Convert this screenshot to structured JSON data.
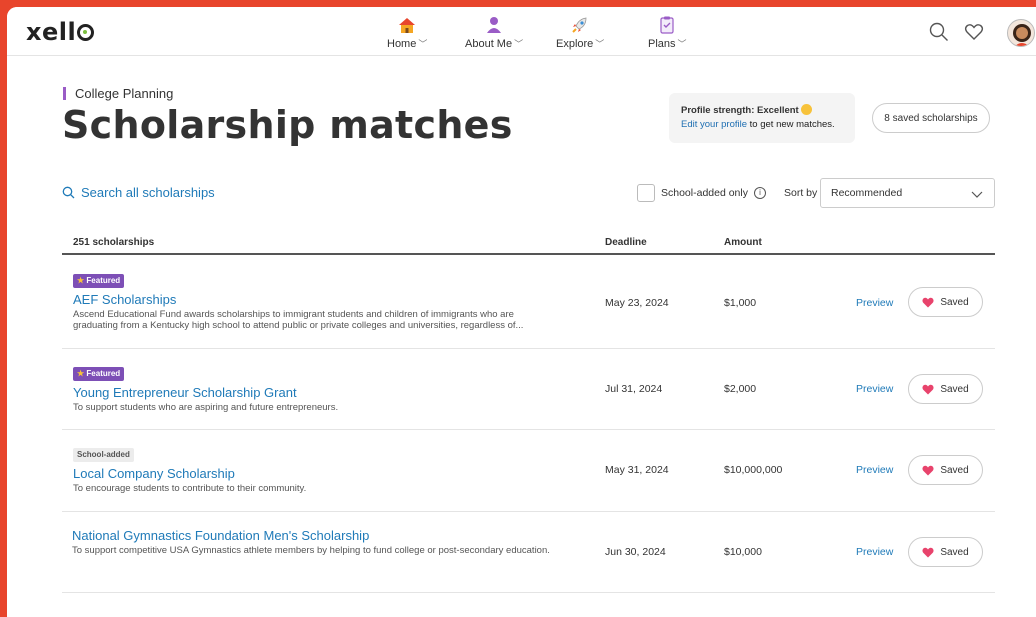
{
  "header": {
    "logo": "xello",
    "nav": [
      {
        "label": "Home",
        "icon": "house-icon"
      },
      {
        "label": "About Me",
        "icon": "person-icon"
      },
      {
        "label": "Explore",
        "icon": "rocket-icon"
      },
      {
        "label": "Plans",
        "icon": "clipboard-icon"
      }
    ]
  },
  "page": {
    "breadcrumb": "College Planning",
    "title": "Scholarship matches",
    "profile_strength": "Profile strength: Excellent",
    "profile_link": "Edit your profile",
    "profile_suffix": " to get new matches.",
    "saved_count_button": "8 saved scholarships"
  },
  "filters": {
    "search_label": "Search all scholarships",
    "school_added_label": "School-added only",
    "sort_label": "Sort by",
    "sort_value": "Recommended"
  },
  "table": {
    "columns": {
      "count": "251 scholarships",
      "deadline": "Deadline",
      "amount": "Amount"
    },
    "rows": [
      {
        "badge": "Featured",
        "title": "AEF Scholarships",
        "description": "Ascend Educational Fund awards scholarships to immigrant students and children of immigrants who are graduating from a Kentucky high school to attend public or private colleges and universities, regardless of...",
        "deadline": "May 23, 2024",
        "amount": "$1,000",
        "preview": "Preview",
        "saved": "Saved"
      },
      {
        "badge": "Featured",
        "title": "Young Entrepreneur Scholarship Grant",
        "description": "To support students who are aspiring and future entrepreneurs.",
        "deadline": "Jul 31, 2024",
        "amount": "$2,000",
        "preview": "Preview",
        "saved": "Saved"
      },
      {
        "badge": "School-added",
        "title": "Local Company Scholarship",
        "description": "To encourage students to contribute to their community.",
        "deadline": "May 31, 2024",
        "amount": "$10,000,000",
        "preview": "Preview",
        "saved": "Saved"
      },
      {
        "badge": "",
        "title": "National Gymnastics Foundation Men's Scholarship",
        "description": "To support competitive USA Gymnastics athlete members by helping to fund college or post-secondary education.",
        "deadline": "Jun 30, 2024",
        "amount": "$10,000",
        "preview": "Preview",
        "saved": "Saved"
      }
    ]
  },
  "colors": {
    "accent_red": "#e8452c",
    "link_blue": "#1f7ab8",
    "featured_purple": "#7d4fb6",
    "heart_pink": "#e8436c"
  }
}
